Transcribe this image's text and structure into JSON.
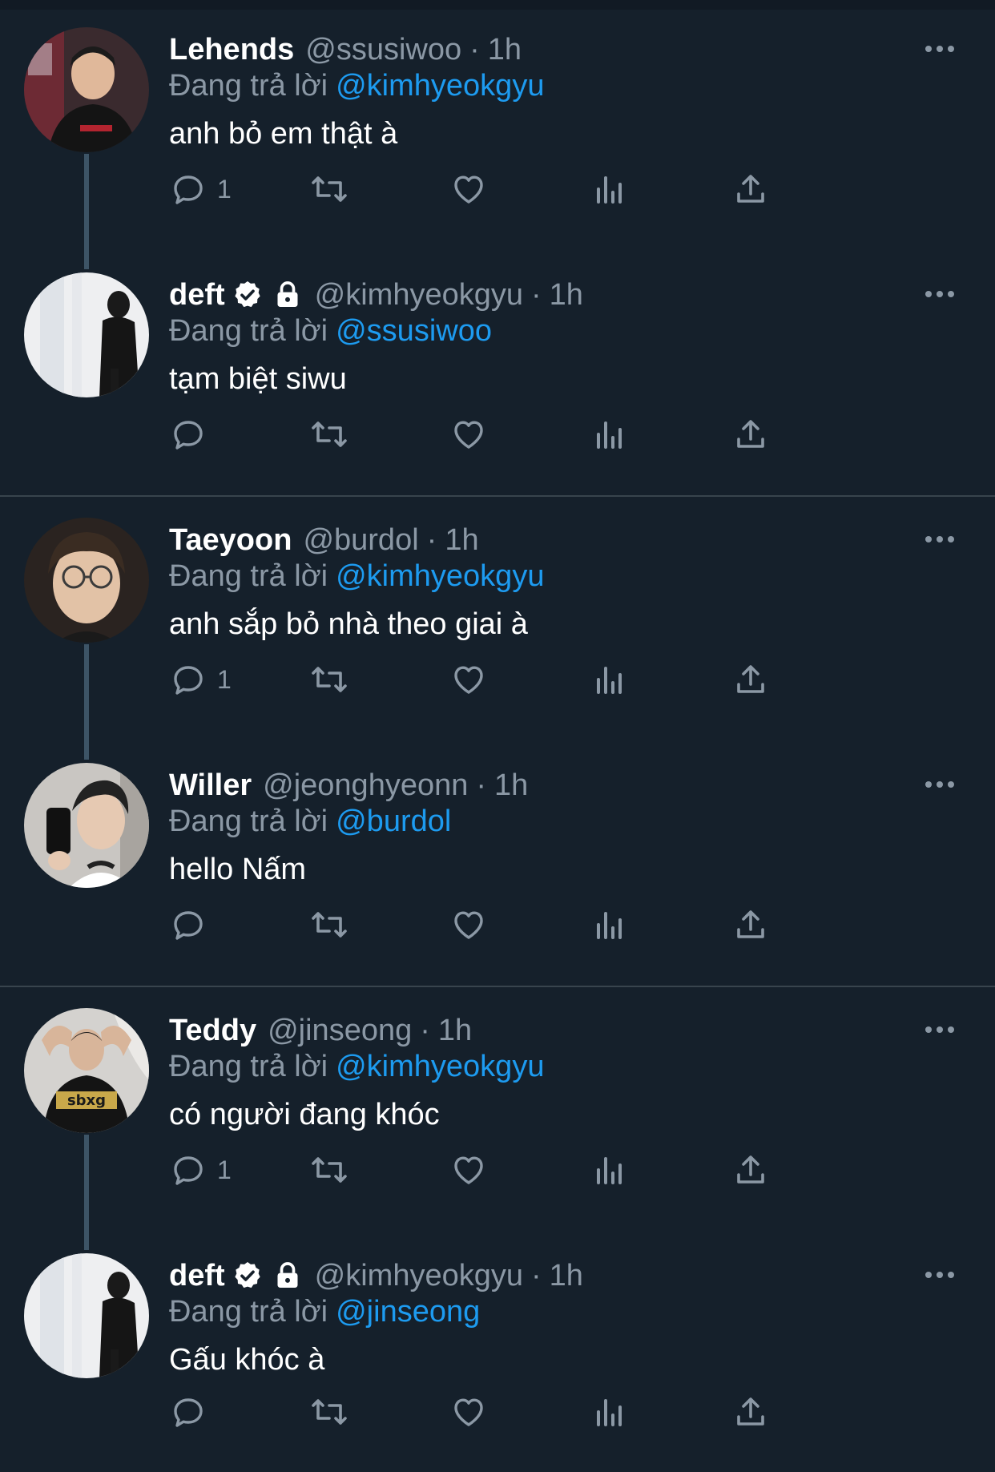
{
  "colors": {
    "background": "#15202b",
    "text_primary": "#ffffff",
    "text_secondary": "#8b98a5",
    "link": "#1d9bf0",
    "thread_line": "#3d5466",
    "divider": "#38444d"
  },
  "tweets": [
    {
      "display_name": "Lehends",
      "handle": "@ssusiwoo",
      "separator": "·",
      "time": "1h",
      "reply_prefix": "Đang trả lời",
      "reply_to": "@kimhyeokgyu",
      "text": "anh bỏ em thật à",
      "reply_count": "1",
      "verified": false,
      "locked": false
    },
    {
      "display_name": "deft",
      "handle": "@kimhyeokgyu",
      "separator": "·",
      "time": "1h",
      "reply_prefix": "Đang trả lời",
      "reply_to": "@ssusiwoo",
      "text": "tạm biệt siwu",
      "reply_count": "",
      "verified": true,
      "locked": true
    },
    {
      "display_name": "Taeyoon",
      "handle": "@burdol",
      "separator": "·",
      "time": "1h",
      "reply_prefix": "Đang trả lời",
      "reply_to": "@kimhyeokgyu",
      "text": "anh sắp bỏ nhà theo giai à",
      "reply_count": "1",
      "verified": false,
      "locked": false
    },
    {
      "display_name": "Willer",
      "handle": "@jeonghyeonn",
      "separator": "·",
      "time": "1h",
      "reply_prefix": "Đang trả lời",
      "reply_to": "@burdol",
      "text": "hello Nấm",
      "reply_count": "",
      "verified": false,
      "locked": false
    },
    {
      "display_name": "Teddy",
      "handle": "@jinseong",
      "separator": "·",
      "time": "1h",
      "reply_prefix": "Đang trả lời",
      "reply_to": "@kimhyeokgyu",
      "text": "có người đang khóc",
      "reply_count": "1",
      "verified": false,
      "locked": false
    },
    {
      "display_name": "deft",
      "handle": "@kimhyeokgyu",
      "separator": "·",
      "time": "1h",
      "reply_prefix": "Đang trả lời",
      "reply_to": "@jinseong",
      "text": "Gấu khóc à",
      "reply_count": "",
      "verified": true,
      "locked": true
    }
  ],
  "icons": {
    "reply": "reply-icon",
    "retweet": "retweet-icon",
    "like": "heart-icon",
    "views": "views-icon",
    "share": "share-icon",
    "more": "more-icon",
    "verified": "verified-badge-icon",
    "locked": "lock-icon"
  }
}
